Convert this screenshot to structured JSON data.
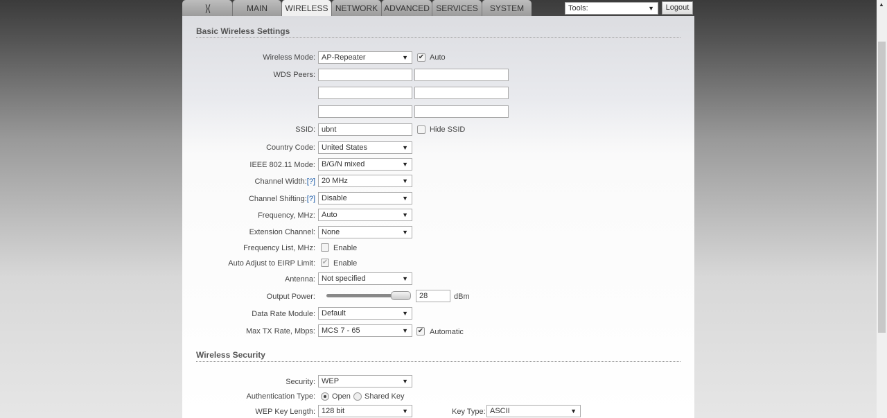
{
  "nav": {
    "tabs": [
      "MAIN",
      "WIRELESS",
      "NETWORK",
      "ADVANCED",
      "SERVICES",
      "SYSTEM"
    ],
    "active": "WIRELESS",
    "tools": "Tools:",
    "logout": "Logout"
  },
  "basic": {
    "title": "Basic Wireless Settings",
    "wireless_mode": {
      "label": "Wireless Mode:",
      "value": "AP-Repeater",
      "auto_label": "Auto",
      "auto": true
    },
    "wds_label": "WDS Peers:",
    "ssid": {
      "label": "SSID:",
      "value": "ubnt",
      "hide_label": "Hide SSID",
      "hide": false
    },
    "country": {
      "label": "Country Code:",
      "value": "United States"
    },
    "ieee": {
      "label": "IEEE 802.11 Mode:",
      "value": "B/G/N mixed"
    },
    "width": {
      "label": "Channel Width:",
      "help": "[?]",
      "value": "20 MHz"
    },
    "shift": {
      "label": "Channel Shifting:",
      "help": "[?]",
      "value": "Disable"
    },
    "freq": {
      "label": "Frequency, MHz:",
      "value": "Auto"
    },
    "ext": {
      "label": "Extension Channel:",
      "value": "None"
    },
    "freqlist": {
      "label": "Frequency List, MHz:",
      "enable": "Enable",
      "checked": false
    },
    "eirp": {
      "label": "Auto Adjust to EIRP Limit:",
      "enable": "Enable",
      "checked": true
    },
    "antenna": {
      "label": "Antenna:",
      "value": "Not specified"
    },
    "power": {
      "label": "Output Power:",
      "value": "28",
      "unit": "dBm",
      "slider_fraction": 1.0
    },
    "datarate": {
      "label": "Data Rate Module:",
      "value": "Default"
    },
    "maxtx": {
      "label": "Max TX Rate, Mbps:",
      "value": "MCS 7 - 65",
      "auto_label": "Automatic",
      "auto": true
    }
  },
  "security": {
    "title": "Wireless Security",
    "security": {
      "label": "Security:",
      "value": "WEP"
    },
    "auth": {
      "label": "Authentication Type:",
      "open": "Open",
      "shared": "Shared Key"
    },
    "keylen": {
      "label": "WEP Key Length:",
      "value": "128 bit"
    },
    "keytype": {
      "label": "Key Type:",
      "value": "ASCII"
    }
  }
}
